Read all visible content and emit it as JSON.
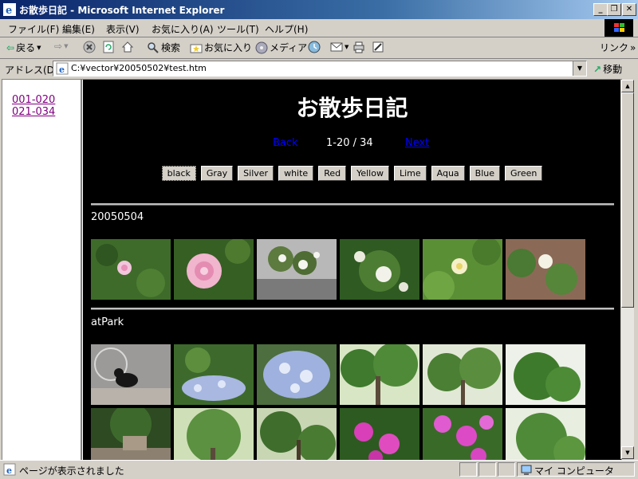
{
  "window": {
    "title": "お散歩日記 - Microsoft Internet Explorer"
  },
  "menu": [
    "ファイル(F)",
    "編集(E)",
    "表示(V)",
    "お気に入り(A)",
    "ツール(T)",
    "ヘルプ(H)"
  ],
  "toolbar": {
    "back": "戻る",
    "search": "検索",
    "favorites": "お気に入り",
    "media": "メディア",
    "links": "リンク"
  },
  "address": {
    "label": "アドレス(D)",
    "url": "C:¥vector¥20050502¥test.htm",
    "go": "移動"
  },
  "sidebar": {
    "links": [
      "001-020",
      "021-034"
    ]
  },
  "page": {
    "title": "お散歩日記",
    "nav": {
      "back": "Back",
      "range": "1-20 / 34",
      "next": "Next"
    },
    "color_buttons": [
      "black",
      "Gray",
      "Silver",
      "white",
      "Red",
      "Yellow",
      "Lime",
      "Aqua",
      "Blue",
      "Green"
    ],
    "sections": [
      {
        "title": "20050504",
        "photo_count": 6
      },
      {
        "title": "atPark",
        "photo_count": 12
      }
    ]
  },
  "status": {
    "text": "ページが表示されました",
    "zone": "マイ コンピュータ"
  }
}
